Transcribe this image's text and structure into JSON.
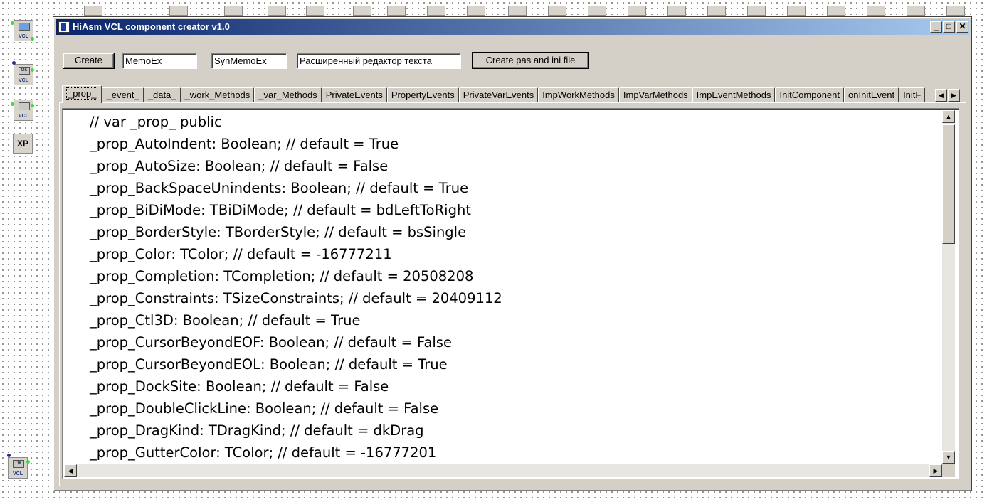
{
  "window": {
    "title": "HiAsm VCL component creator v1.0",
    "controls": {
      "minimize": "_",
      "maximize": "□",
      "close": "✕"
    }
  },
  "toolbar": {
    "create_label": "Create",
    "field1_value": "MemoEx",
    "field2_value": "SynMemoEx",
    "field3_value": "Расширенный редактор текста",
    "create_files_label": "Create pas and ini file"
  },
  "tabs": [
    "_prop_",
    "_event_",
    "_data_",
    "_work_Methods",
    "_var_Methods",
    "PrivateEvents",
    "PropertyEvents",
    "PrivateVarEvents",
    "ImpWorkMethods",
    "ImpVarMethods",
    "ImpEventMethods",
    "InitComponent",
    "onInitEvent",
    "InitF"
  ],
  "active_tab": 0,
  "editor": {
    "lines": [
      "// var _prop_ public",
      "_prop_AutoIndent: Boolean; // default = True",
      "_prop_AutoSize: Boolean; // default = False",
      "_prop_BackSpaceUnindents: Boolean; // default = True",
      "_prop_BiDiMode: TBiDiMode; // default = bdLeftToRight",
      "_prop_BorderStyle: TBorderStyle; // default = bsSingle",
      "_prop_Color: TColor; // default = -16777211",
      "_prop_Completion: TCompletion; // default = 20508208",
      "_prop_Constraints: TSizeConstraints; // default = 20409112",
      "_prop_Ctl3D: Boolean; // default = True",
      "_prop_CursorBeyondEOF: Boolean; // default = False",
      "_prop_CursorBeyondEOL: Boolean; // default = True",
      "_prop_DockSite: Boolean; // default = False",
      "_prop_DoubleClickLine: Boolean; // default = False",
      "_prop_DragKind: TDragKind; // default = dkDrag",
      "_prop_GutterColor: TColor; // default = -16777201"
    ]
  },
  "palette": {
    "vcl_label": "VCL",
    "ok_label": "OK",
    "xp_label": "XP"
  },
  "colors": {
    "title_start": "#0a246a",
    "title_end": "#a6caf0",
    "face": "#d4d0c8"
  }
}
